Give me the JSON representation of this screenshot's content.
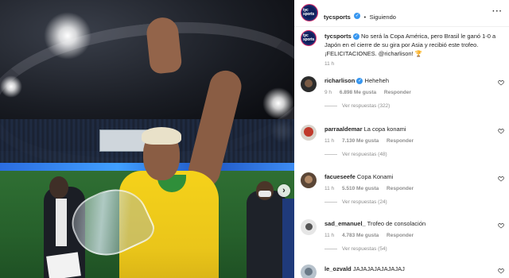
{
  "post": {
    "username": "tycsports",
    "follow_status": "Siguiendo",
    "avatar_text": "tyc sports",
    "caption_username": "tycsports",
    "caption_text": "No será la Copa América, pero Brasil le ganó 1-0 a Japón en el cierre de su gira por Asia y recibió este trofeo. ¡FELICITACIONES. @richarlison! 🏆",
    "caption_time": "11 h"
  },
  "comments": [
    {
      "username": "richarlison",
      "verified": true,
      "text": "Heheheh",
      "time": "9 h",
      "likes": "6.898 Me gusta",
      "reply_label": "Responder",
      "replies": "Ver respuestas (322)"
    },
    {
      "username": "parraaldemar",
      "verified": false,
      "text": "La copa konami",
      "time": "11 h",
      "likes": "7.130 Me gusta",
      "reply_label": "Responder",
      "replies": "Ver respuestas (48)"
    },
    {
      "username": "facueseefe",
      "verified": false,
      "text": "Copa Konami",
      "time": "11 h",
      "likes": "5.510 Me gusta",
      "reply_label": "Responder",
      "replies": "Ver respuestas (24)"
    },
    {
      "username": "sad_emanuel_",
      "verified": false,
      "text": "Trofeo de consolación",
      "time": "11 h",
      "likes": "4.783 Me gusta",
      "reply_label": "Responder",
      "replies": "Ver respuestas (54)"
    },
    {
      "username": "le_ozvald",
      "verified": false,
      "text": "JAJAJAJAJAJAJAJ",
      "time": "",
      "likes": "",
      "reply_label": "",
      "replies": ""
    }
  ],
  "colors": {
    "verified": "#3897f0",
    "muted": "#8e8e8e",
    "text": "#262626",
    "shirt": "#f5d21a"
  },
  "icons": {
    "more": "more-horizontal-icon",
    "like": "heart-outline-icon",
    "next": "chevron-right-icon"
  }
}
